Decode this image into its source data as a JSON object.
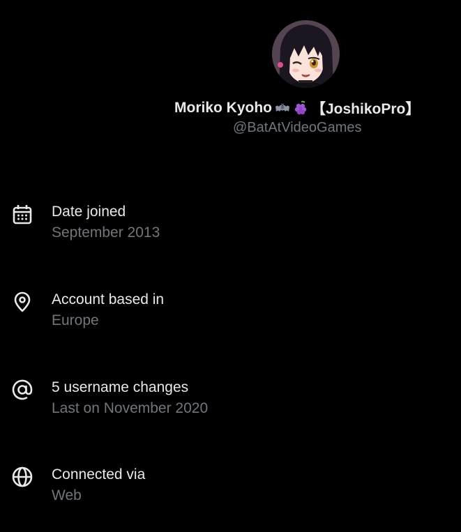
{
  "profile": {
    "display_name_prefix": "Moriko Kyoho",
    "display_name_suffix": "【JoshikoPro】",
    "emoji_1": "bat-emoji",
    "emoji_2": "grapes-emoji",
    "handle": "@BatAtVideoGames",
    "avatar": "anime-girl-avatar"
  },
  "details": [
    {
      "icon": "calendar-icon",
      "title": "Date joined",
      "value": "September 2013"
    },
    {
      "icon": "location-pin-icon",
      "title": "Account based in",
      "value": "Europe"
    },
    {
      "icon": "at-sign-icon",
      "title": "5 username changes",
      "value": "Last on November 2020"
    },
    {
      "icon": "globe-icon",
      "title": "Connected via",
      "value": "Web"
    }
  ],
  "colors": {
    "background": "#000000",
    "primary_text": "#e7e9ea",
    "secondary_text": "#71767b"
  }
}
